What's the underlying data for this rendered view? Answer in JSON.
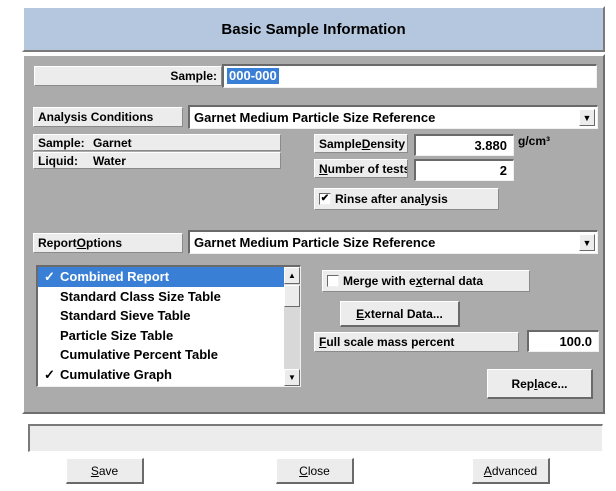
{
  "window": {
    "title": "Basic Sample Information"
  },
  "sample": {
    "label": "Sample:",
    "value": "000-000"
  },
  "analysis_conditions": {
    "label": "Analysis Conditions",
    "selected": "Garnet Medium Particle Size Reference",
    "sample_label": "Sample:",
    "sample_value": "Garnet",
    "liquid_label": "Liquid:",
    "liquid_value": "Water"
  },
  "sample_density": {
    "label_pre": "Sample ",
    "label_u": "D",
    "label_post": "ensity",
    "value": "3.880",
    "unit": "g/cm³"
  },
  "number_of_tests": {
    "label_u": "N",
    "label_post": "umber of tests",
    "value": "2"
  },
  "rinse": {
    "checked": true,
    "label_pre": "Rinse after ana",
    "label_u": "l",
    "label_post": "ysis"
  },
  "report_options": {
    "label_pre": "Report ",
    "label_u": "O",
    "label_post": "ptions",
    "selected": "Garnet Medium Particle Size Reference",
    "items": [
      {
        "label": "Combined Report",
        "checked": true,
        "selected": true
      },
      {
        "label": "Standard Class Size Table",
        "checked": false,
        "selected": false
      },
      {
        "label": "Standard Sieve Table",
        "checked": false,
        "selected": false
      },
      {
        "label": "Particle Size Table",
        "checked": false,
        "selected": false
      },
      {
        "label": "Cumulative Percent Table",
        "checked": false,
        "selected": false
      },
      {
        "label": "Cumulative Graph",
        "checked": true,
        "selected": false
      }
    ]
  },
  "merge": {
    "checked": false,
    "label_pre": "Merge with e",
    "label_u": "x",
    "label_post": "ternal data"
  },
  "external_data_button": {
    "label_u": "E",
    "label_post": "xternal Data..."
  },
  "full_scale": {
    "label_u": "F",
    "label_post": "ull scale mass percent",
    "value": "100.0"
  },
  "replace_button": {
    "label_pre": "Rep",
    "label_u": "l",
    "label_post": "ace..."
  },
  "status": {
    "text": ""
  },
  "buttons": {
    "save": {
      "label_u": "S",
      "label_post": "ave"
    },
    "close": {
      "label_u": "C",
      "label_post": "lose"
    },
    "advanced": {
      "label_u": "A",
      "label_post": "dvanced"
    }
  },
  "colors": {
    "title_bg": "#b5c7de",
    "panel_bg": "#ababab",
    "selection": "#3a7fd6",
    "sample_value_bg": "#3a7fd6"
  }
}
